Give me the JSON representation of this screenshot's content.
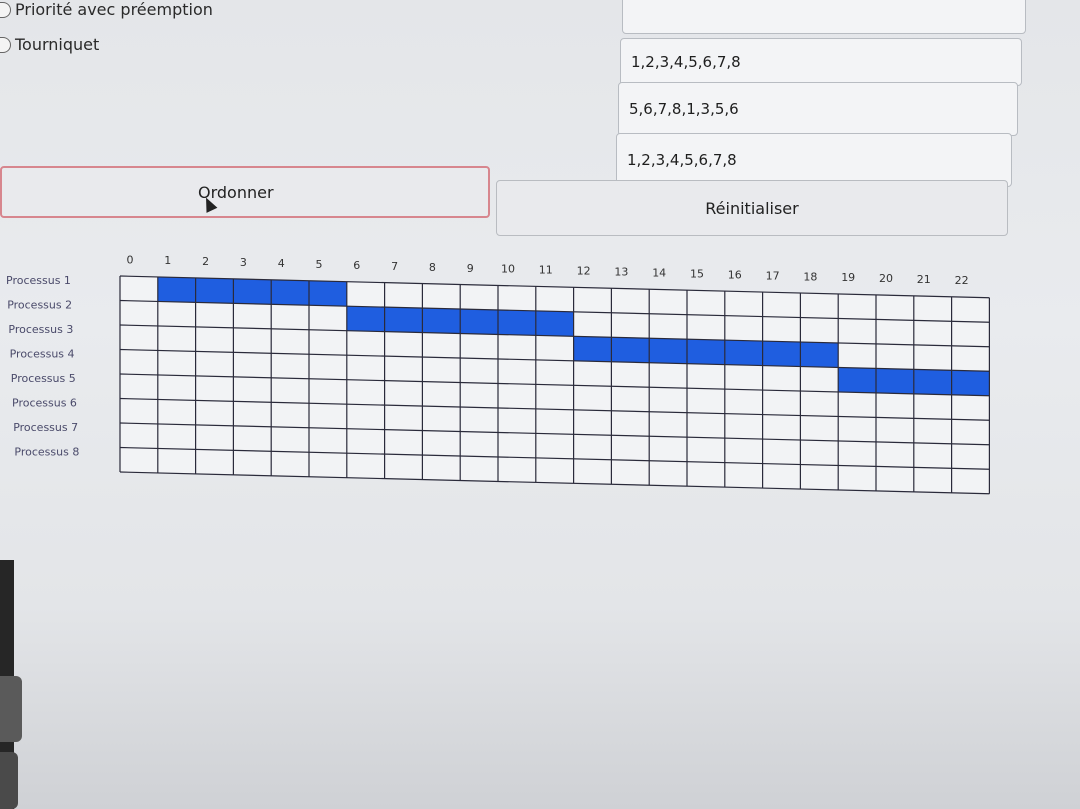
{
  "algorithms": {
    "priority_preemptive_label": "Priorité avec préemption",
    "round_robin_label": "Tourniquet"
  },
  "sequences": [
    "1,2,3,4,5,6,7,8",
    "5,6,7,8,1,3,5,6",
    "1,2,3,4,5,6,7,8"
  ],
  "buttons": {
    "order_label": "Ordonner",
    "reset_label": "Réinitialiser"
  },
  "gantt": {
    "time_ticks": [
      "0",
      "1",
      "2",
      "3",
      "4",
      "5",
      "6",
      "7",
      "8",
      "9",
      "10",
      "11",
      "12",
      "13",
      "14",
      "15",
      "16",
      "17",
      "18",
      "19",
      "20",
      "21",
      "22"
    ],
    "processes": [
      "Processus 1",
      "Processus 2",
      "Processus 3",
      "Processus 4",
      "Processus 5",
      "Processus 6",
      "Processus 7",
      "Processus 8"
    ],
    "bar_color": "#1f5ee0"
  },
  "chart_data": {
    "type": "gantt",
    "unit": "time",
    "tasks": [
      {
        "name": "Processus 1",
        "start": 1,
        "end": 6
      },
      {
        "name": "Processus 2",
        "start": 6,
        "end": 12
      },
      {
        "name": "Processus 3",
        "start": 12,
        "end": 19
      },
      {
        "name": "Processus 4",
        "start": 19,
        "end": 23
      }
    ]
  }
}
